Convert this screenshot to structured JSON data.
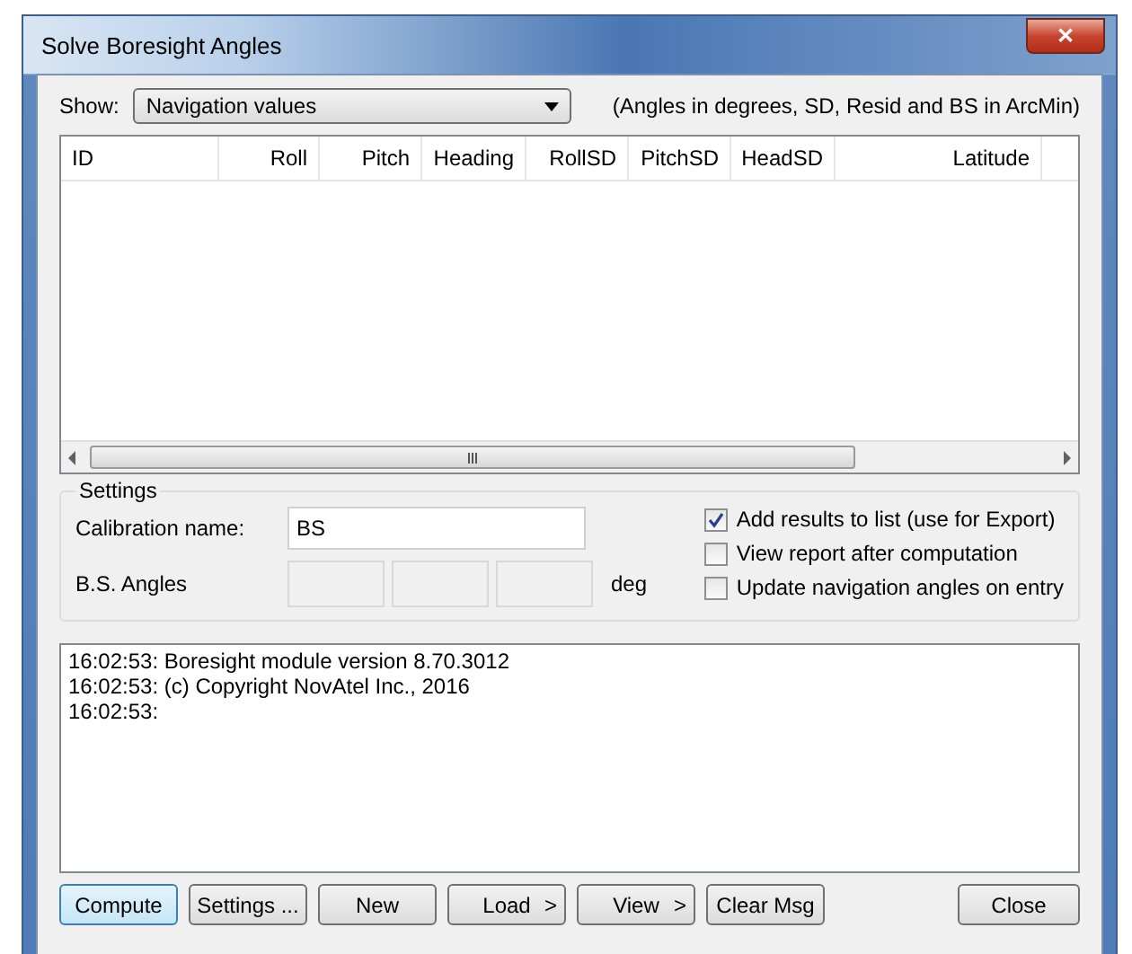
{
  "window": {
    "title": "Solve Boresight Angles",
    "close_glyph": "✕"
  },
  "show": {
    "label": "Show:",
    "value": "Navigation values",
    "note": "(Angles in degrees, SD, Resid and BS in ArcMin)"
  },
  "table": {
    "columns": [
      {
        "label": "ID"
      },
      {
        "label": "Roll"
      },
      {
        "label": "Pitch"
      },
      {
        "label": "Heading"
      },
      {
        "label": "RollSD"
      },
      {
        "label": "PitchSD"
      },
      {
        "label": "HeadSD"
      },
      {
        "label": "Latitude"
      }
    ]
  },
  "settings": {
    "title": "Settings",
    "calibration_label": "Calibration name:",
    "calibration_value": "BS",
    "angles_label": "B.S. Angles",
    "angles_unit": "deg",
    "options": [
      {
        "label": "Add results to list (use for Export)",
        "checked": true
      },
      {
        "label": "View report after computation",
        "checked": false
      },
      {
        "label": "Update navigation angles on entry",
        "checked": false
      }
    ]
  },
  "log": [
    "16:02:53: Boresight module version 8.70.3012",
    "16:02:53: (c) Copyright NovAtel Inc., 2016",
    "16:02:53:"
  ],
  "buttons": [
    {
      "label": "Compute",
      "default": true
    },
    {
      "label": "Settings ...",
      "default": false
    },
    {
      "label": "New",
      "default": false
    },
    {
      "label": "Load",
      "default": false,
      "arrow": ">"
    },
    {
      "label": "View",
      "default": false,
      "arrow": ">"
    },
    {
      "label": "Clear Msg",
      "default": false
    }
  ],
  "close_button": {
    "label": "Close"
  }
}
